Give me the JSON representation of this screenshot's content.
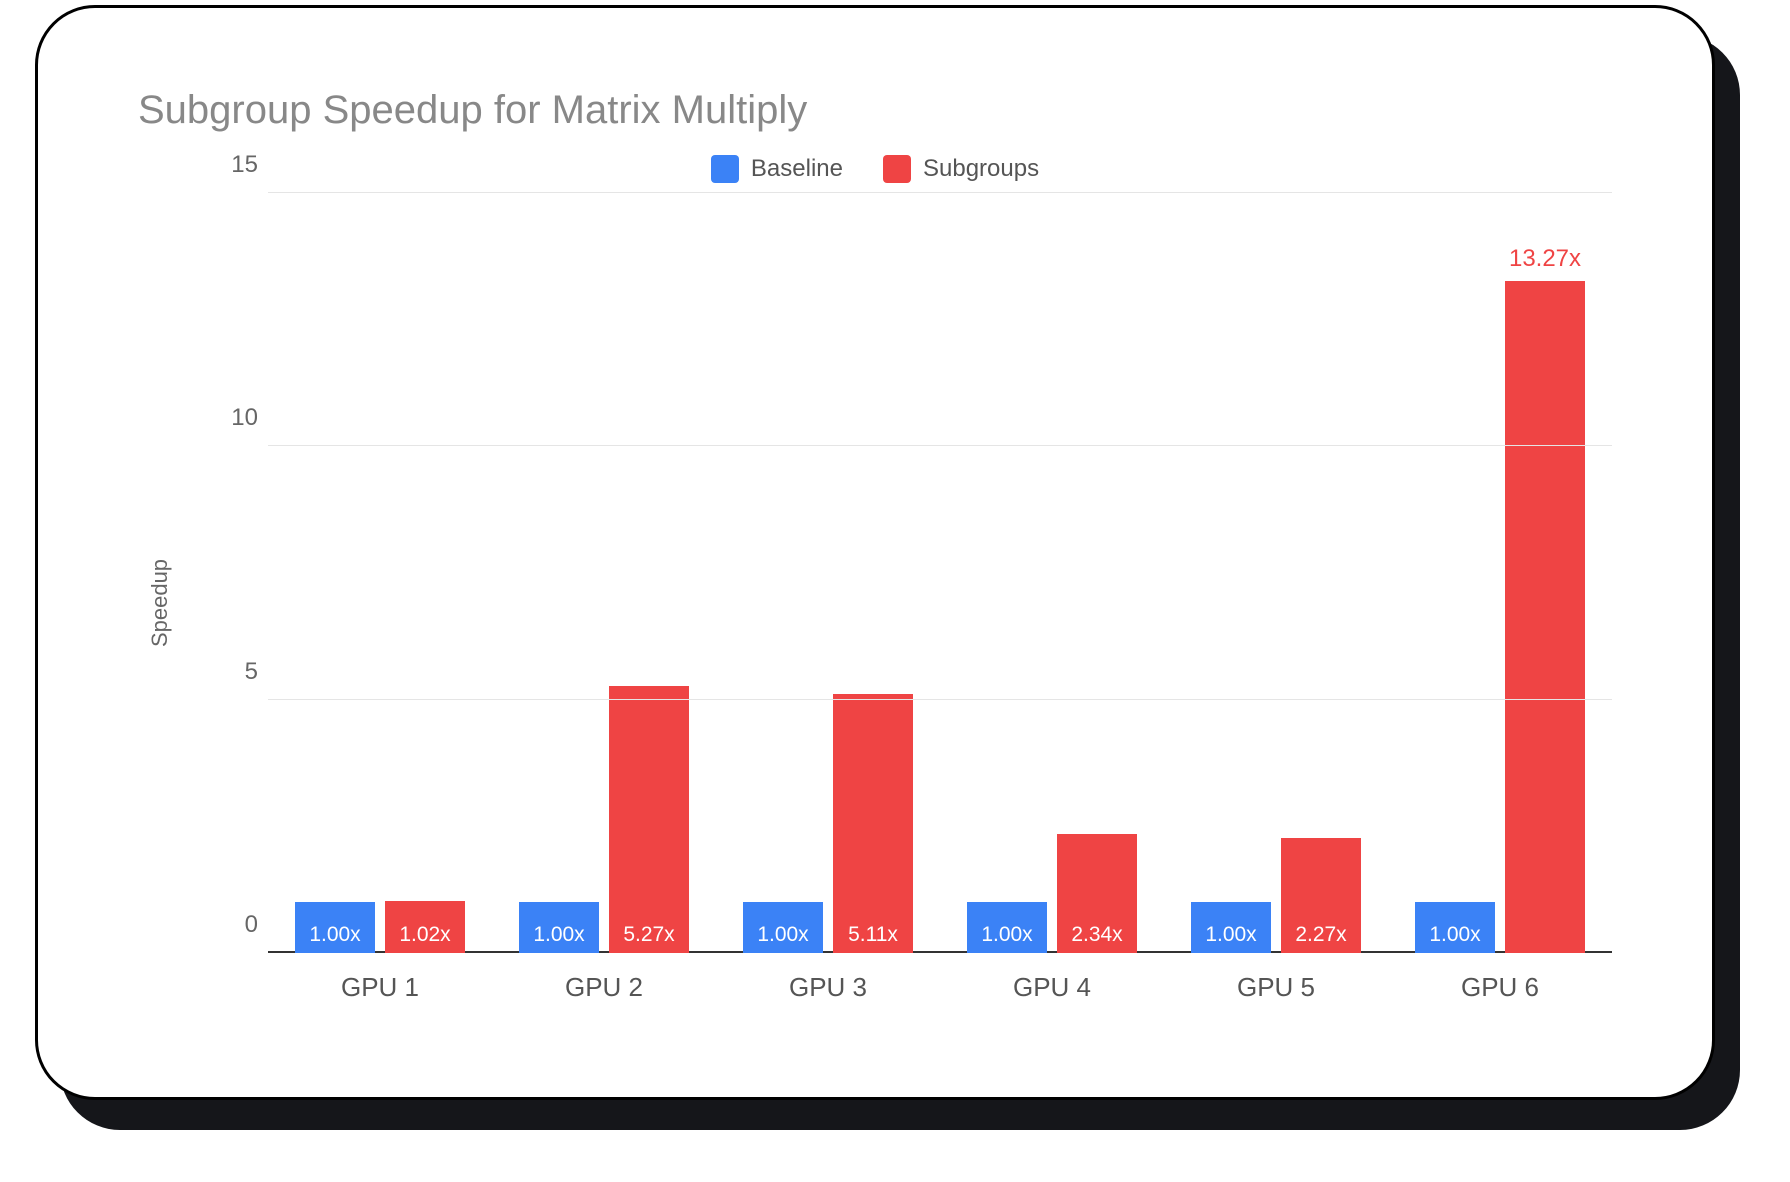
{
  "chart_data": {
    "type": "bar",
    "title": "Subgroup Speedup for Matrix Multiply",
    "ylabel": "Speedup",
    "ylim": [
      0,
      15
    ],
    "yticks": [
      0,
      5,
      10,
      15
    ],
    "categories": [
      "GPU 1",
      "GPU 2",
      "GPU 3",
      "GPU 4",
      "GPU 5",
      "GPU 6"
    ],
    "series": [
      {
        "name": "Baseline",
        "color": "#3b82f6",
        "values": [
          1.0,
          1.0,
          1.0,
          1.0,
          1.0,
          1.0
        ]
      },
      {
        "name": "Subgroups",
        "color": "#ef4444",
        "values": [
          1.02,
          5.27,
          5.11,
          2.34,
          2.27,
          13.27
        ]
      }
    ],
    "labels": {
      "baseline": [
        "1.00x",
        "1.00x",
        "1.00x",
        "1.00x",
        "1.00x",
        "1.00x"
      ],
      "subgroups": [
        "1.02x",
        "5.27x",
        "5.11x",
        "2.34x",
        "2.27x",
        "13.27x"
      ]
    },
    "label_positions": {
      "baseline": [
        "in",
        "in",
        "in",
        "in",
        "in",
        "in"
      ],
      "subgroups": [
        "in",
        "in",
        "in",
        "in",
        "in",
        "out"
      ]
    }
  }
}
